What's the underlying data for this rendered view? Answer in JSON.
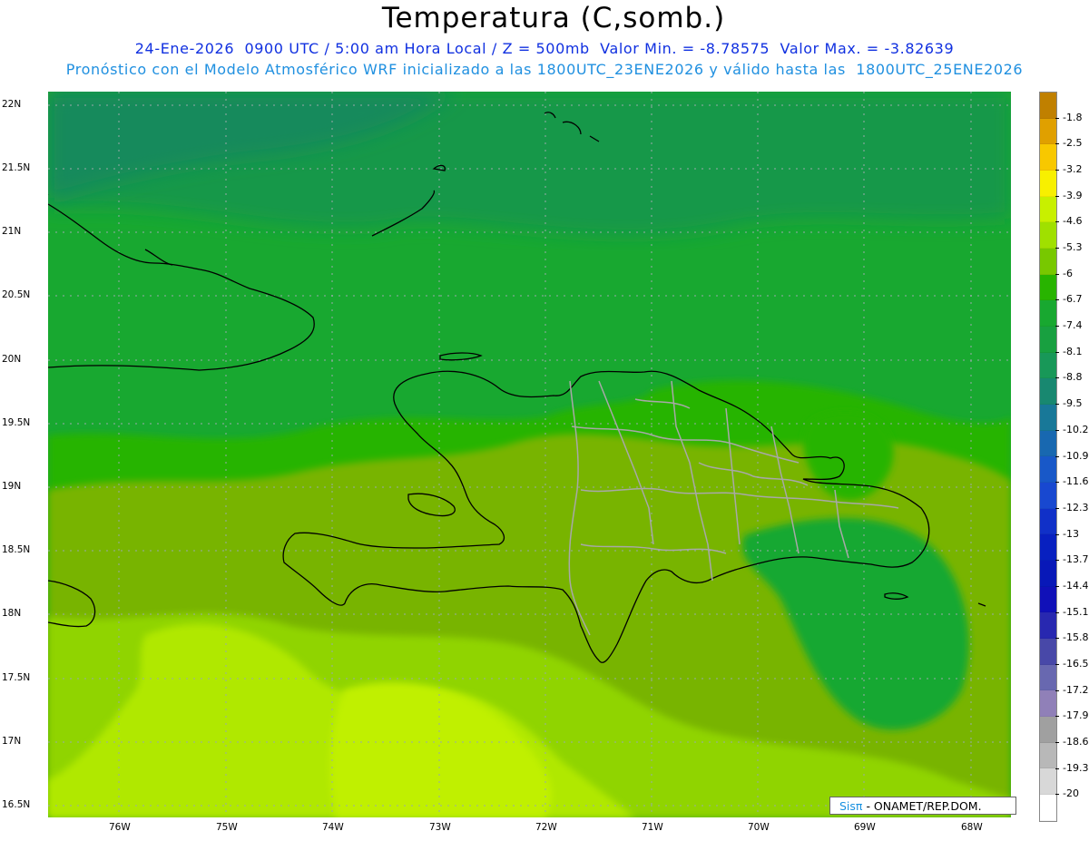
{
  "header": {
    "title": "Temperatura (C,somb.)",
    "line1": "24-Ene-2026  0900 UTC / 5:00 am Hora Local / Z = 500mb  Valor Min. = -8.78575  Valor Max. = -3.82639",
    "line2": "Pronóstico con el Modelo Atmosférico WRF inicializado a las 1800UTC_23ENE2026 y válido hasta las  1800UTC_25ENE2026"
  },
  "axes": {
    "lat_labels": [
      "22N",
      "21.5N",
      "21N",
      "20.5N",
      "20N",
      "19.5N",
      "19N",
      "18.5N",
      "18N",
      "17.5N",
      "17N",
      "16.5N"
    ],
    "lon_labels": [
      "76W",
      "75W",
      "74W",
      "73W",
      "72W",
      "71W",
      "70W",
      "69W",
      "68W"
    ]
  },
  "colorbar": {
    "labels": [
      "-1.8",
      "-2.5",
      "-3.2",
      "-3.9",
      "-4.6",
      "-5.3",
      "-6",
      "-6.7",
      "-7.4",
      "-8.1",
      "-8.8",
      "-9.5",
      "-10.2",
      "-10.9",
      "-11.6",
      "-12.3",
      "-13",
      "-13.7",
      "-14.4",
      "-15.1",
      "-15.8",
      "-16.5",
      "-17.2",
      "-17.9",
      "-18.6",
      "-19.3",
      "-20"
    ],
    "colors": [
      "#c08000",
      "#e0a000",
      "#f8c800",
      "#f8f000",
      "#c8f000",
      "#a0e000",
      "#78c800",
      "#28b400",
      "#18a830",
      "#18a040",
      "#189858",
      "#188870",
      "#187898",
      "#1868b0",
      "#1858c8",
      "#1848d0",
      "#1030c8",
      "#0820c0",
      "#0818b8",
      "#1010b8",
      "#2828b0",
      "#4848a8",
      "#6868b0",
      "#9080b8",
      "#a0a0a0",
      "#b8b8b8",
      "#d8d8d8",
      "#ffffff"
    ]
  },
  "credit": {
    "brand": "SisPI",
    "brand_display": "Sisπ",
    "text": "- ONAMET/REP.DOM."
  }
}
